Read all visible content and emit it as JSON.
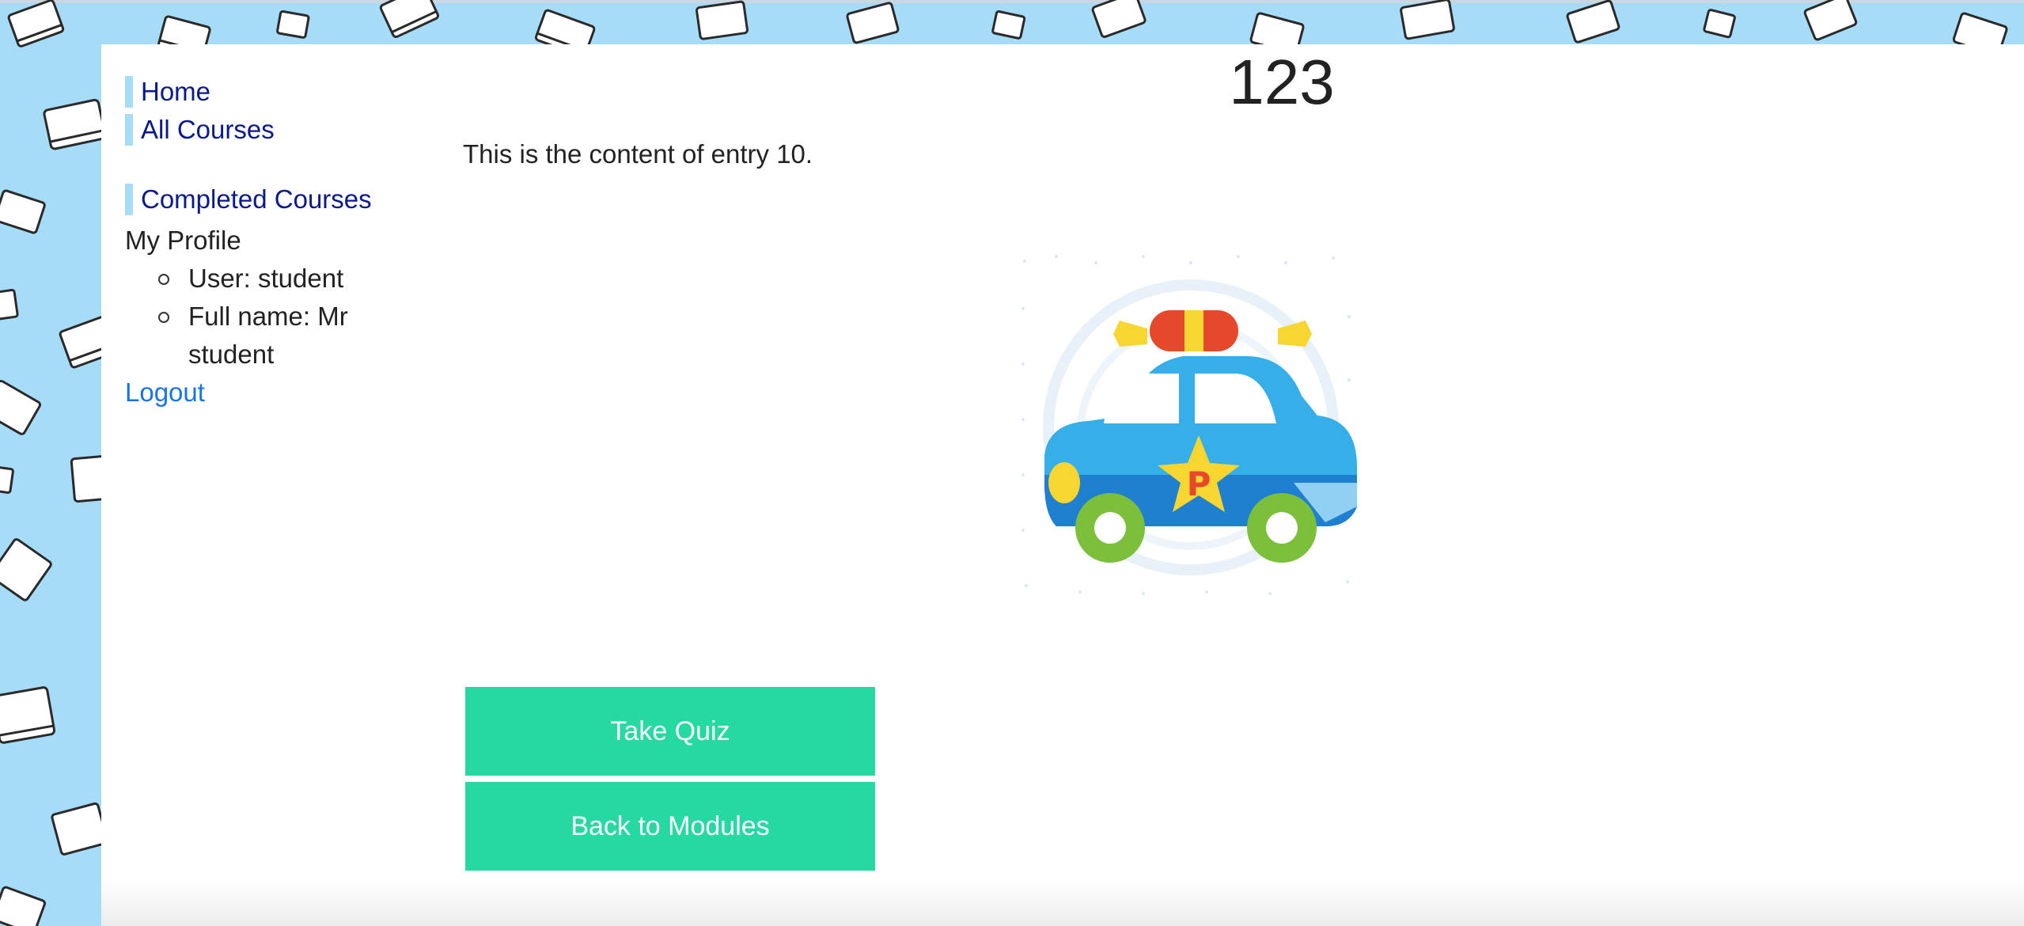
{
  "sidebar": {
    "nav": [
      {
        "label": "Home"
      },
      {
        "label": "All Courses"
      },
      {
        "label": "Completed Courses"
      }
    ],
    "profile": {
      "title": "My Profile",
      "user": "User: student",
      "full_name": "Full name: Mr student"
    },
    "logout": "Logout"
  },
  "main": {
    "heading": "123",
    "entry_text": "This is the content of entry 10.",
    "illustration": {
      "icon": "police-car-icon",
      "badge_letter": "P"
    },
    "buttons": {
      "take_quiz": "Take Quiz",
      "back_to_modules": "Back to Modules"
    }
  },
  "colors": {
    "background": "#a6dcf7",
    "nav_accent": "#a6dcf7",
    "nav_text": "#0b1a8a",
    "link": "#1a73e8",
    "button": "#26d9a2"
  }
}
